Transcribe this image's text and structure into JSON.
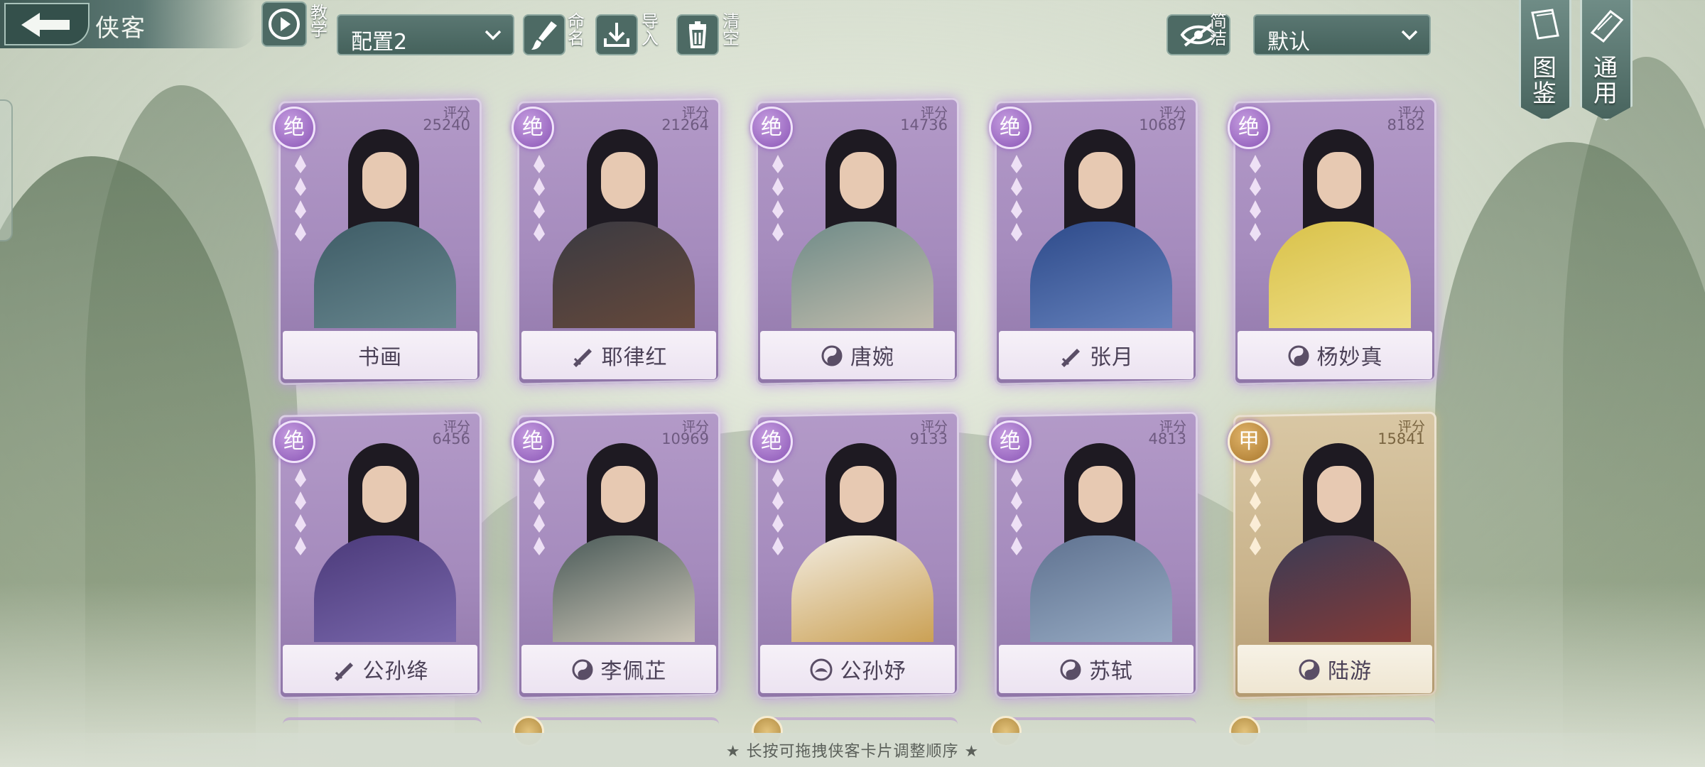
{
  "header": {
    "title": "侠客",
    "tutorial_label": "教学",
    "config_select": "配置2",
    "rename_label": "命名",
    "import_label": "导入",
    "clear_label": "清空",
    "simple_label": "简洁",
    "sort_select": "默认",
    "codex_label": "图鉴",
    "general_label": "通用"
  },
  "score_label": "评分",
  "cards": [
    {
      "name": "书画",
      "score": "25240",
      "rank": "绝",
      "tier": "purple",
      "class_icon": "none"
    },
    {
      "name": "耶律红",
      "score": "21264",
      "rank": "绝",
      "tier": "purple",
      "class_icon": "sword-icon"
    },
    {
      "name": "唐婉",
      "score": "14736",
      "rank": "绝",
      "tier": "purple",
      "class_icon": "yin-yang-icon"
    },
    {
      "name": "张月",
      "score": "10687",
      "rank": "绝",
      "tier": "purple",
      "class_icon": "sword-icon"
    },
    {
      "name": "杨妙真",
      "score": "8182",
      "rank": "绝",
      "tier": "purple",
      "class_icon": "yin-yang-icon"
    },
    {
      "name": "公孙绛",
      "score": "6456",
      "rank": "绝",
      "tier": "purple",
      "class_icon": "sword-icon"
    },
    {
      "name": "李佩芷",
      "score": "10969",
      "rank": "绝",
      "tier": "purple",
      "class_icon": "yin-yang-icon"
    },
    {
      "name": "公孙妤",
      "score": "9133",
      "rank": "绝",
      "tier": "purple",
      "class_icon": "lotus-icon"
    },
    {
      "name": "苏轼",
      "score": "4813",
      "rank": "绝",
      "tier": "purple",
      "class_icon": "yin-yang-icon"
    },
    {
      "name": "陆游",
      "score": "15841",
      "rank": "甲",
      "tier": "gold",
      "class_icon": "yin-yang-icon"
    }
  ],
  "footer": {
    "hint": "★ 长按可拖拽侠客卡片调整顺序 ★"
  },
  "colors": {
    "accent_teal": "#4d6a64",
    "card_purple": "#a58bbd",
    "card_gold": "#c9b38b"
  }
}
